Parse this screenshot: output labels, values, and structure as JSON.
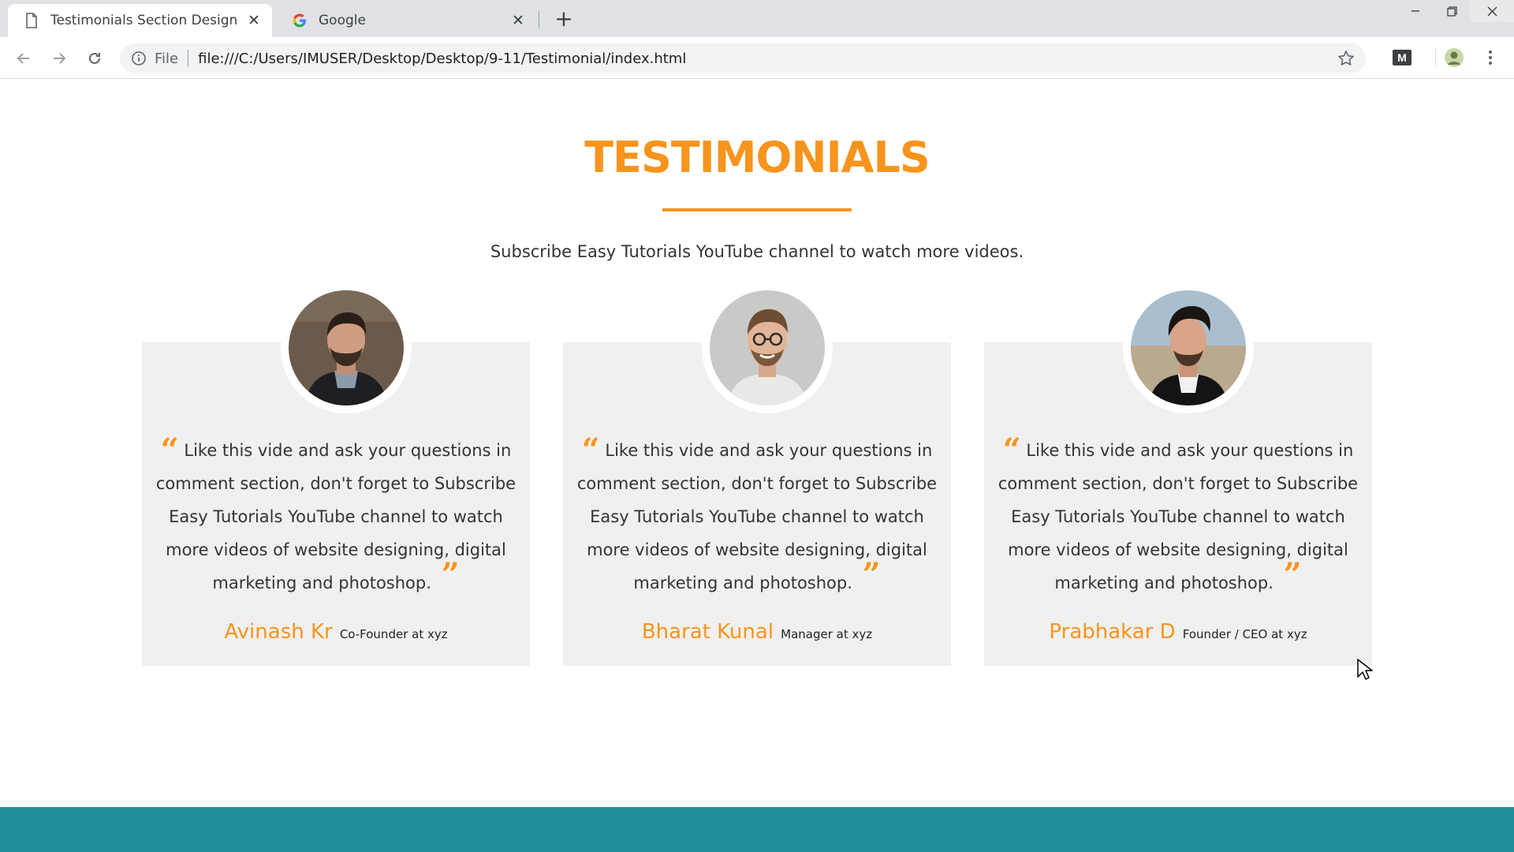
{
  "browser": {
    "tabs": [
      {
        "title": "Testimonials Section Design",
        "active": true,
        "icon": "document-icon"
      },
      {
        "title": "Google",
        "active": false,
        "icon": "google-icon"
      }
    ],
    "omnibox": {
      "scheme": "File",
      "url": "file:///C:/Users/IMUSER/Desktop/Desktop/9-11/Testimonial/index.html"
    },
    "extension_label": "M"
  },
  "page": {
    "heading": "TESTIMONIALS",
    "subtitle": "Subscribe Easy Tutorials YouTube channel to watch more videos.",
    "accent_color": "#f7941d",
    "footer_color": "#1f8f99",
    "testimonials": [
      {
        "text": "Like this vide and ask your questions in comment section, don't forget to Subscribe Easy Tutorials YouTube channel to watch more videos of website designing, digital marketing and photoshop.",
        "name": "Avinash Kr",
        "role": "Co-Founder at xyz"
      },
      {
        "text": "Like this vide and ask your questions in comment section, don't forget to Subscribe Easy Tutorials YouTube channel to watch more videos of website designing, digital marketing and photoshop.",
        "name": "Bharat Kunal",
        "role": "Manager at xyz"
      },
      {
        "text": "Like this vide and ask your questions in comment section, don't forget to Subscribe Easy Tutorials YouTube channel to watch more videos of website designing, digital marketing and photoshop.",
        "name": "Prabhakar D",
        "role": "Founder / CEO at xyz"
      }
    ]
  }
}
